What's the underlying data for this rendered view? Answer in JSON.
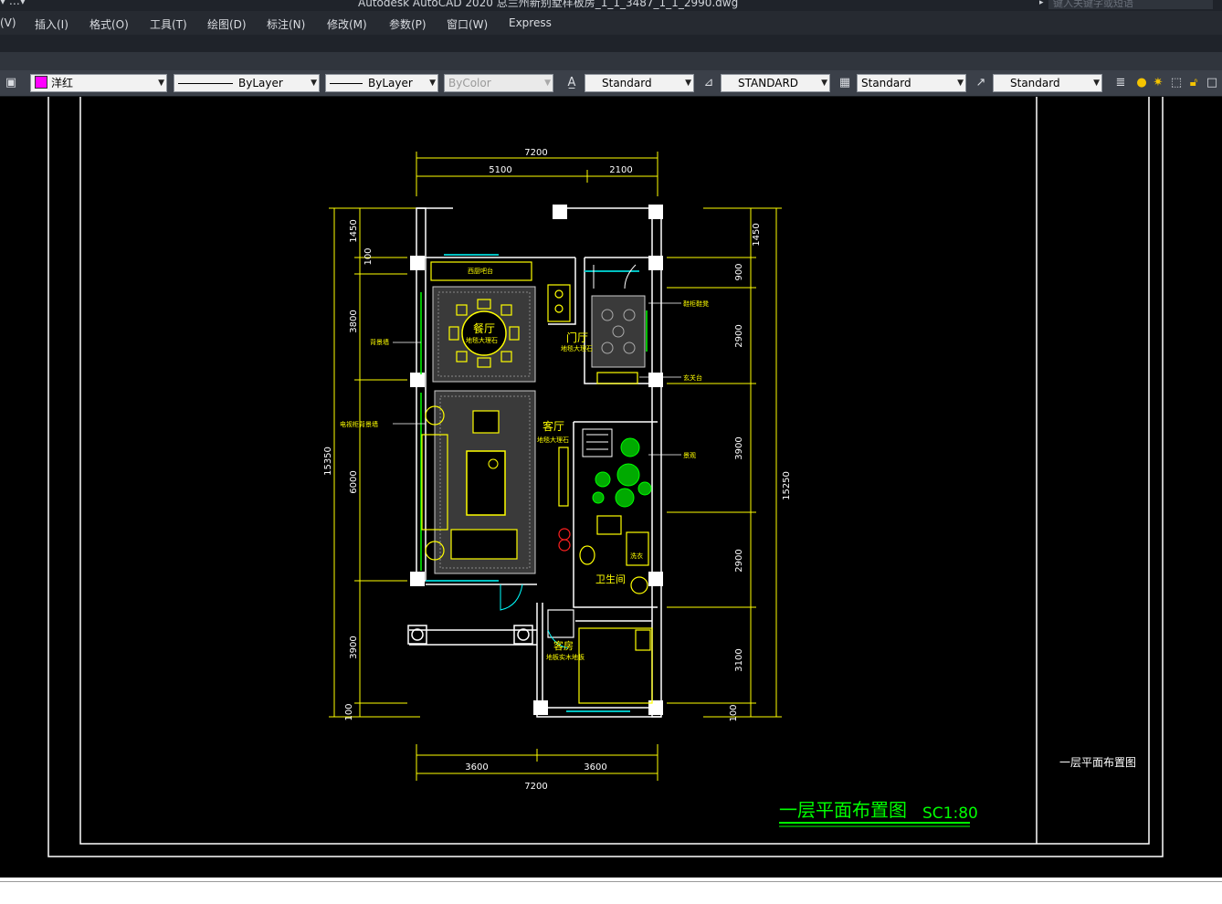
{
  "window": {
    "title": "Autodesk AutoCAD 2020    总兰州新别墅样板房_1_1_3487_1_1_2990.dwg",
    "search_placeholder": "键入关键字或短语",
    "quick_access": "▾ …▾"
  },
  "menu": {
    "items": [
      "(V)",
      "插入(I)",
      "格式(O)",
      "工具(T)",
      "绘图(D)",
      "标注(N)",
      "修改(M)",
      "参数(P)",
      "窗口(W)",
      "Express"
    ]
  },
  "toolbar": {
    "layer_value": "洋红",
    "layer_color": "#ff00ff",
    "linetype_value": "ByLayer",
    "lineweight_value": "ByLayer",
    "plotstyle_value": "ByColor",
    "text_style_value": "Standard",
    "dim_style_value": "STANDARD",
    "table_style_value": "Standard",
    "mleader_style_value": "Standard"
  },
  "drawing": {
    "title_main": "一层平面布置图",
    "title_scale": "SC1:80",
    "titleblock_label": "一层平面布置图",
    "colors": {
      "walls": "#ffffff",
      "dimensions": "#ffff00",
      "title": "#00ff00",
      "windows": "#00c0c0",
      "furniture": "#ffff00",
      "plants": "#00ff00"
    },
    "dims": {
      "top_total": "7200",
      "top_left": "5100",
      "top_right": "2100",
      "bottom_left": "3600",
      "bottom_right": "3600",
      "bottom_total": "7200",
      "left_total": "15350",
      "left_segments": [
        "1450",
        "100",
        "3800",
        "6000",
        "3900",
        "100"
      ],
      "right_total": "15250",
      "right_segments": [
        "1450",
        "900",
        "2900",
        "3900",
        "2900",
        "3100",
        "100"
      ]
    },
    "rooms": {
      "dining": "餐厅",
      "dining_sub": "地毯大理石",
      "foyer": "门厅",
      "foyer_sub": "地毯大理石",
      "living": "客厅",
      "living_sub": "地毯大理石",
      "bathroom": "卫生间",
      "guestroom": "客房",
      "guestroom_sub": "地板实木地板"
    },
    "notes": {
      "kitchen_counter": "西厨吧台",
      "feature_wall": "背景墙",
      "tv_wall": "电视柜背景墙",
      "shoe_cabinet": "鞋柜鞋凳",
      "entry_table": "玄关台",
      "landscape": "景观",
      "laundry": "洗衣"
    }
  }
}
